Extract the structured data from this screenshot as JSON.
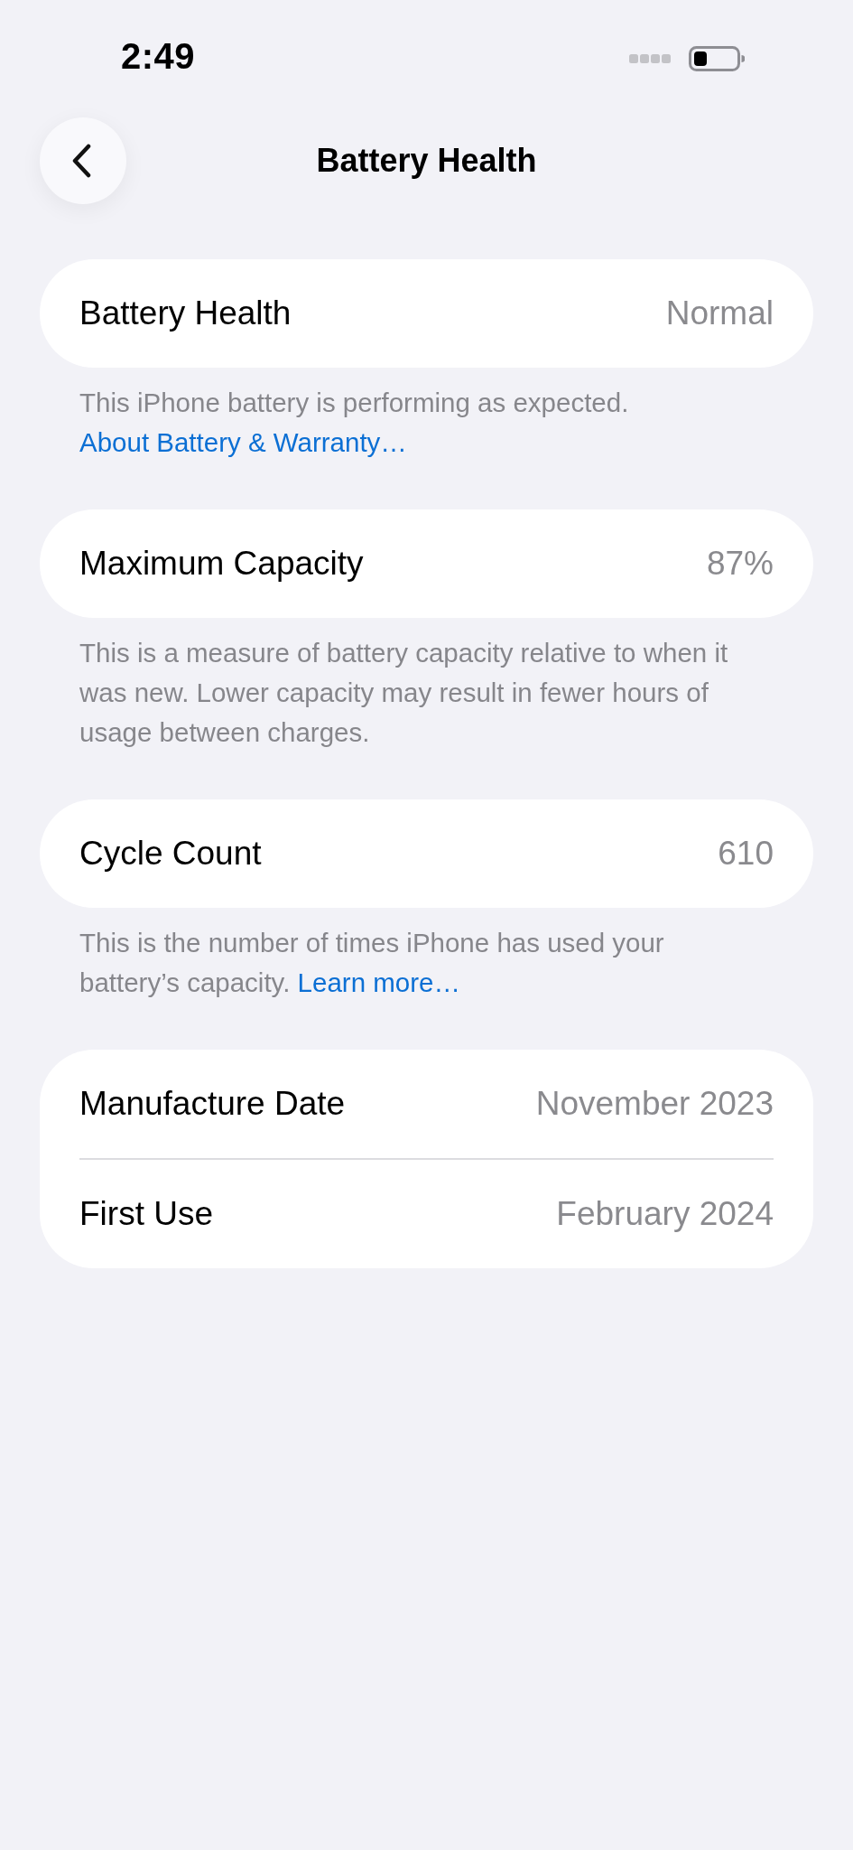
{
  "status_bar": {
    "time": "2:49"
  },
  "nav": {
    "title": "Battery Health"
  },
  "sections": [
    {
      "rows": [
        {
          "label": "Battery Health",
          "value": "Normal"
        }
      ],
      "footer": {
        "text": "This iPhone battery is performing as expected.",
        "link": "About Battery & Warranty…"
      }
    },
    {
      "rows": [
        {
          "label": "Maximum Capacity",
          "value": "87%"
        }
      ],
      "footer": {
        "text": "This is a measure of battery capacity relative to when it was new. Lower capacity may result in fewer hours of usage between charges."
      }
    },
    {
      "rows": [
        {
          "label": "Cycle Count",
          "value": "610"
        }
      ],
      "footer": {
        "text": "This is the number of times iPhone has used your battery’s capacity.",
        "link": "Learn more…"
      }
    },
    {
      "rows": [
        {
          "label": "Manufacture Date",
          "value": "November 2023"
        },
        {
          "label": "First Use",
          "value": "February 2024"
        }
      ]
    }
  ]
}
